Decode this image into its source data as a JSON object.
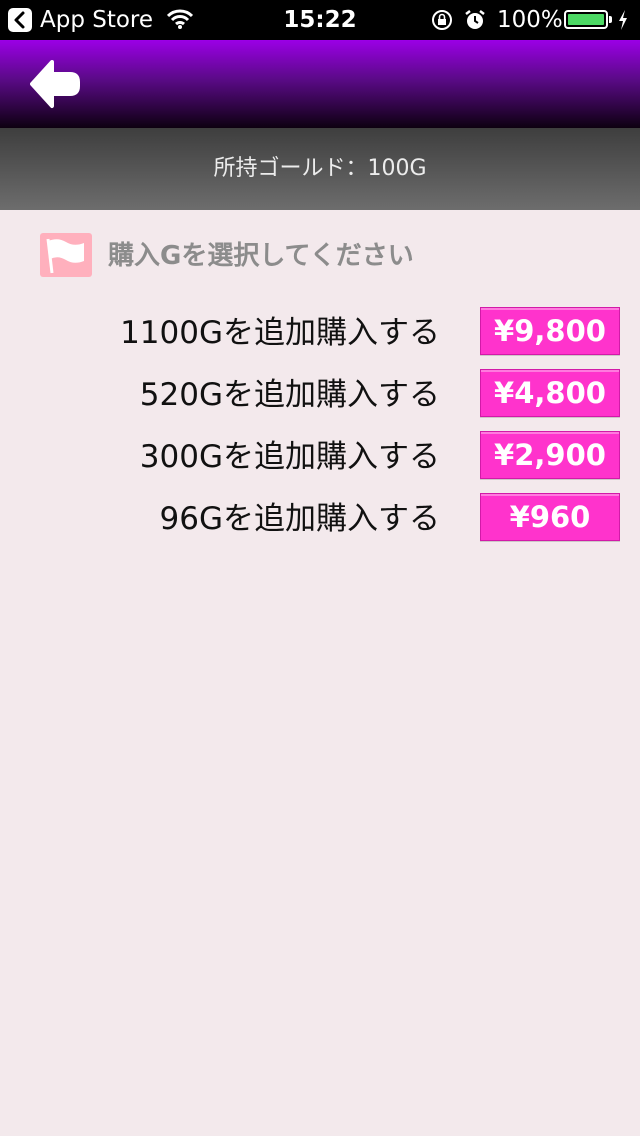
{
  "status_bar": {
    "back_app": "App Store",
    "time": "15:22",
    "battery_percent_label": "100%",
    "battery_level": 1.0,
    "battery_color": "#4cd964"
  },
  "header": {
    "back_icon": "back-arrow-icon"
  },
  "gold": {
    "label": "所持ゴールド：100G"
  },
  "section": {
    "icon": "flag-icon",
    "title": "購入Gを選択してください"
  },
  "options": [
    {
      "label": "1100Gを追加購入する",
      "price": "¥9,800"
    },
    {
      "label": "520Gを追加購入する",
      "price": "¥4,800"
    },
    {
      "label": "300Gを追加購入する",
      "price": "¥2,900"
    },
    {
      "label": "96Gを追加購入する",
      "price": "¥960"
    }
  ],
  "colors": {
    "header_top": "#9b00e6",
    "price_button": "#ff33cc",
    "background": "#f3e9ec",
    "flag_icon_bg": "#ffb0bd"
  }
}
